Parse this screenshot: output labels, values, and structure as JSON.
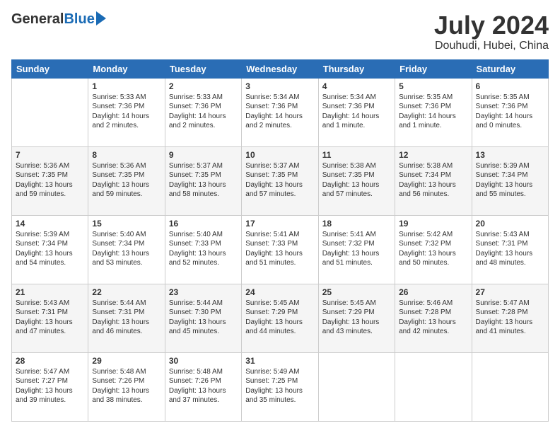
{
  "header": {
    "logo_general": "General",
    "logo_blue": "Blue",
    "month_title": "July 2024",
    "location": "Douhudi, Hubei, China"
  },
  "calendar": {
    "columns": [
      "Sunday",
      "Monday",
      "Tuesday",
      "Wednesday",
      "Thursday",
      "Friday",
      "Saturday"
    ],
    "weeks": [
      [
        {
          "day": "",
          "sunrise": "",
          "sunset": "",
          "daylight": ""
        },
        {
          "day": "1",
          "sunrise": "Sunrise: 5:33 AM",
          "sunset": "Sunset: 7:36 PM",
          "daylight": "Daylight: 14 hours and 2 minutes."
        },
        {
          "day": "2",
          "sunrise": "Sunrise: 5:33 AM",
          "sunset": "Sunset: 7:36 PM",
          "daylight": "Daylight: 14 hours and 2 minutes."
        },
        {
          "day": "3",
          "sunrise": "Sunrise: 5:34 AM",
          "sunset": "Sunset: 7:36 PM",
          "daylight": "Daylight: 14 hours and 2 minutes."
        },
        {
          "day": "4",
          "sunrise": "Sunrise: 5:34 AM",
          "sunset": "Sunset: 7:36 PM",
          "daylight": "Daylight: 14 hours and 1 minute."
        },
        {
          "day": "5",
          "sunrise": "Sunrise: 5:35 AM",
          "sunset": "Sunset: 7:36 PM",
          "daylight": "Daylight: 14 hours and 1 minute."
        },
        {
          "day": "6",
          "sunrise": "Sunrise: 5:35 AM",
          "sunset": "Sunset: 7:36 PM",
          "daylight": "Daylight: 14 hours and 0 minutes."
        }
      ],
      [
        {
          "day": "7",
          "sunrise": "Sunrise: 5:36 AM",
          "sunset": "Sunset: 7:35 PM",
          "daylight": "Daylight: 13 hours and 59 minutes."
        },
        {
          "day": "8",
          "sunrise": "Sunrise: 5:36 AM",
          "sunset": "Sunset: 7:35 PM",
          "daylight": "Daylight: 13 hours and 59 minutes."
        },
        {
          "day": "9",
          "sunrise": "Sunrise: 5:37 AM",
          "sunset": "Sunset: 7:35 PM",
          "daylight": "Daylight: 13 hours and 58 minutes."
        },
        {
          "day": "10",
          "sunrise": "Sunrise: 5:37 AM",
          "sunset": "Sunset: 7:35 PM",
          "daylight": "Daylight: 13 hours and 57 minutes."
        },
        {
          "day": "11",
          "sunrise": "Sunrise: 5:38 AM",
          "sunset": "Sunset: 7:35 PM",
          "daylight": "Daylight: 13 hours and 57 minutes."
        },
        {
          "day": "12",
          "sunrise": "Sunrise: 5:38 AM",
          "sunset": "Sunset: 7:34 PM",
          "daylight": "Daylight: 13 hours and 56 minutes."
        },
        {
          "day": "13",
          "sunrise": "Sunrise: 5:39 AM",
          "sunset": "Sunset: 7:34 PM",
          "daylight": "Daylight: 13 hours and 55 minutes."
        }
      ],
      [
        {
          "day": "14",
          "sunrise": "Sunrise: 5:39 AM",
          "sunset": "Sunset: 7:34 PM",
          "daylight": "Daylight: 13 hours and 54 minutes."
        },
        {
          "day": "15",
          "sunrise": "Sunrise: 5:40 AM",
          "sunset": "Sunset: 7:34 PM",
          "daylight": "Daylight: 13 hours and 53 minutes."
        },
        {
          "day": "16",
          "sunrise": "Sunrise: 5:40 AM",
          "sunset": "Sunset: 7:33 PM",
          "daylight": "Daylight: 13 hours and 52 minutes."
        },
        {
          "day": "17",
          "sunrise": "Sunrise: 5:41 AM",
          "sunset": "Sunset: 7:33 PM",
          "daylight": "Daylight: 13 hours and 51 minutes."
        },
        {
          "day": "18",
          "sunrise": "Sunrise: 5:41 AM",
          "sunset": "Sunset: 7:32 PM",
          "daylight": "Daylight: 13 hours and 51 minutes."
        },
        {
          "day": "19",
          "sunrise": "Sunrise: 5:42 AM",
          "sunset": "Sunset: 7:32 PM",
          "daylight": "Daylight: 13 hours and 50 minutes."
        },
        {
          "day": "20",
          "sunrise": "Sunrise: 5:43 AM",
          "sunset": "Sunset: 7:31 PM",
          "daylight": "Daylight: 13 hours and 48 minutes."
        }
      ],
      [
        {
          "day": "21",
          "sunrise": "Sunrise: 5:43 AM",
          "sunset": "Sunset: 7:31 PM",
          "daylight": "Daylight: 13 hours and 47 minutes."
        },
        {
          "day": "22",
          "sunrise": "Sunrise: 5:44 AM",
          "sunset": "Sunset: 7:31 PM",
          "daylight": "Daylight: 13 hours and 46 minutes."
        },
        {
          "day": "23",
          "sunrise": "Sunrise: 5:44 AM",
          "sunset": "Sunset: 7:30 PM",
          "daylight": "Daylight: 13 hours and 45 minutes."
        },
        {
          "day": "24",
          "sunrise": "Sunrise: 5:45 AM",
          "sunset": "Sunset: 7:29 PM",
          "daylight": "Daylight: 13 hours and 44 minutes."
        },
        {
          "day": "25",
          "sunrise": "Sunrise: 5:45 AM",
          "sunset": "Sunset: 7:29 PM",
          "daylight": "Daylight: 13 hours and 43 minutes."
        },
        {
          "day": "26",
          "sunrise": "Sunrise: 5:46 AM",
          "sunset": "Sunset: 7:28 PM",
          "daylight": "Daylight: 13 hours and 42 minutes."
        },
        {
          "day": "27",
          "sunrise": "Sunrise: 5:47 AM",
          "sunset": "Sunset: 7:28 PM",
          "daylight": "Daylight: 13 hours and 41 minutes."
        }
      ],
      [
        {
          "day": "28",
          "sunrise": "Sunrise: 5:47 AM",
          "sunset": "Sunset: 7:27 PM",
          "daylight": "Daylight: 13 hours and 39 minutes."
        },
        {
          "day": "29",
          "sunrise": "Sunrise: 5:48 AM",
          "sunset": "Sunset: 7:26 PM",
          "daylight": "Daylight: 13 hours and 38 minutes."
        },
        {
          "day": "30",
          "sunrise": "Sunrise: 5:48 AM",
          "sunset": "Sunset: 7:26 PM",
          "daylight": "Daylight: 13 hours and 37 minutes."
        },
        {
          "day": "31",
          "sunrise": "Sunrise: 5:49 AM",
          "sunset": "Sunset: 7:25 PM",
          "daylight": "Daylight: 13 hours and 35 minutes."
        },
        {
          "day": "",
          "sunrise": "",
          "sunset": "",
          "daylight": ""
        },
        {
          "day": "",
          "sunrise": "",
          "sunset": "",
          "daylight": ""
        },
        {
          "day": "",
          "sunrise": "",
          "sunset": "",
          "daylight": ""
        }
      ]
    ]
  }
}
